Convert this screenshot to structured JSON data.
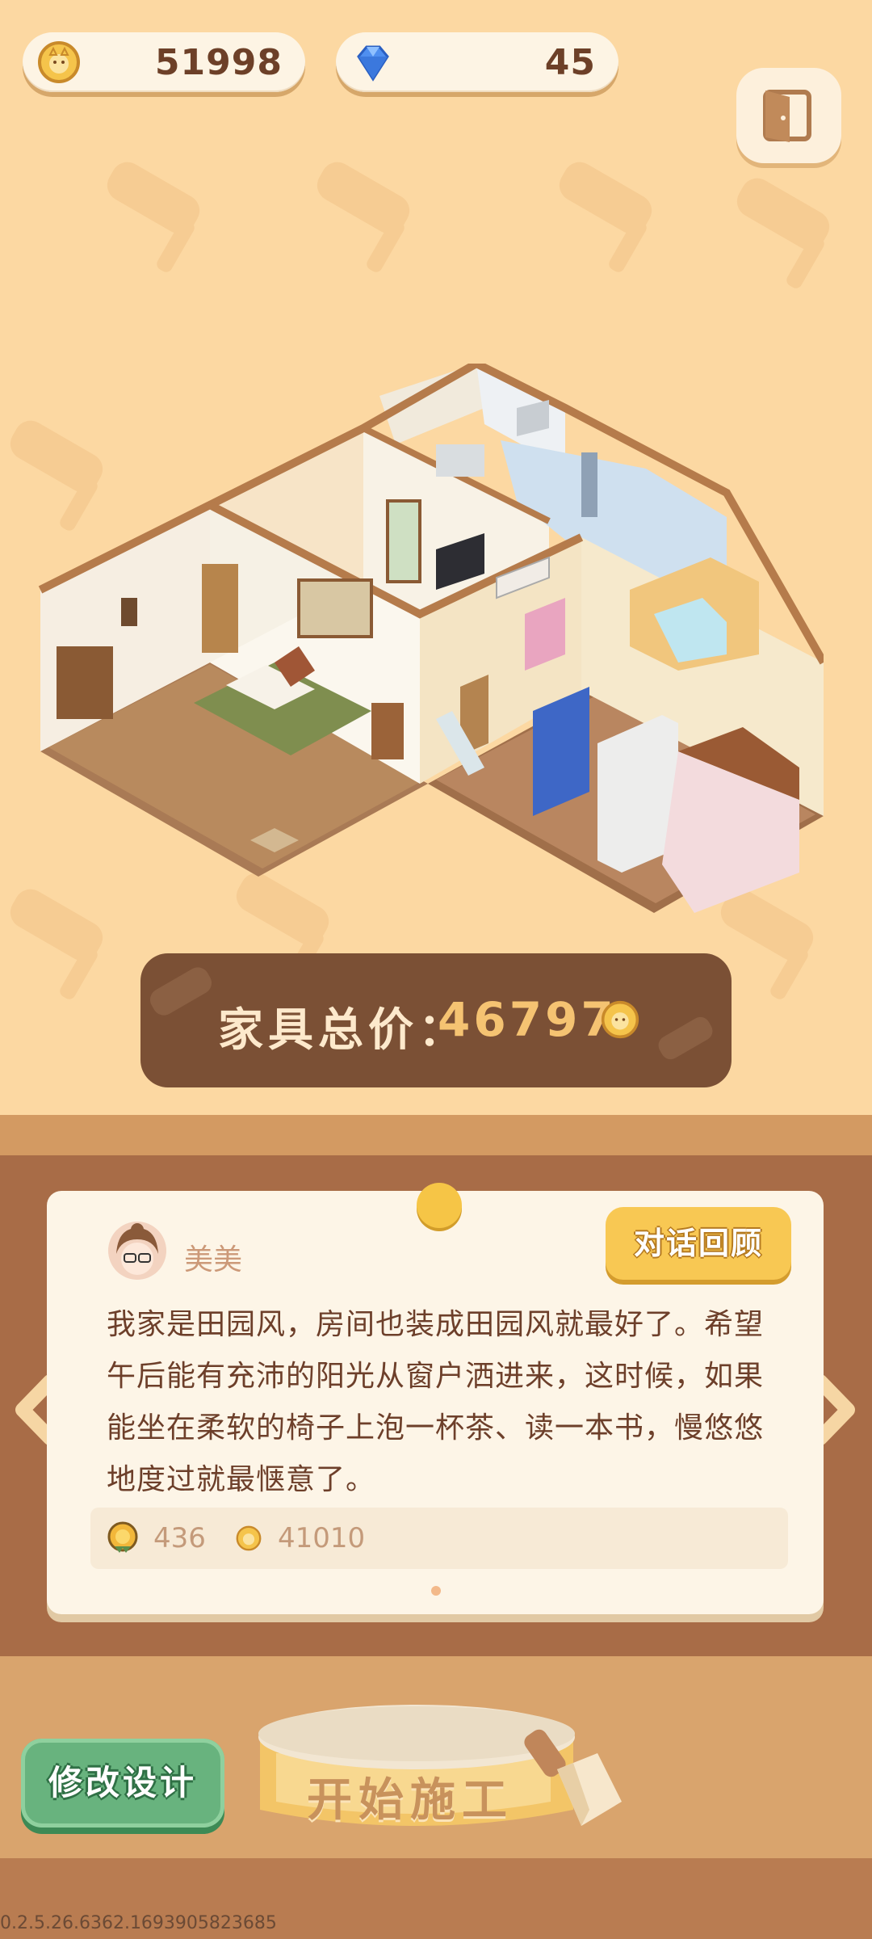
{
  "currency": {
    "coins": "51998",
    "gems": "45"
  },
  "furniture_price": {
    "label": "家具总价：",
    "value": "46797"
  },
  "npc": {
    "name": "美美",
    "dialog_review_label": "对话回顾",
    "message": "我家是田园风，房间也装成田园风就最好了。希望午后能有充沛的阳光从窗户洒进来，这时候，如果能坐在柔软的椅子上泡一杯茶、读一本书，慢悠悠地度过就最惬意了。"
  },
  "rewards": {
    "medal_value": "436",
    "coin_value": "41010"
  },
  "buttons": {
    "modify_design": "修改设计",
    "start_construction": "开始施工"
  },
  "version": "0.2.5.26.6362.1693905823685",
  "colors": {
    "background": "#fcd8a2",
    "banner": "#7b5035",
    "accent_gold": "#f5c372",
    "green_button": "#68b37e"
  },
  "icons": [
    "coin-icon",
    "gem-icon",
    "exit-door-icon",
    "medal-icon",
    "arrow-left-icon",
    "arrow-right-icon",
    "brush-icon"
  ]
}
